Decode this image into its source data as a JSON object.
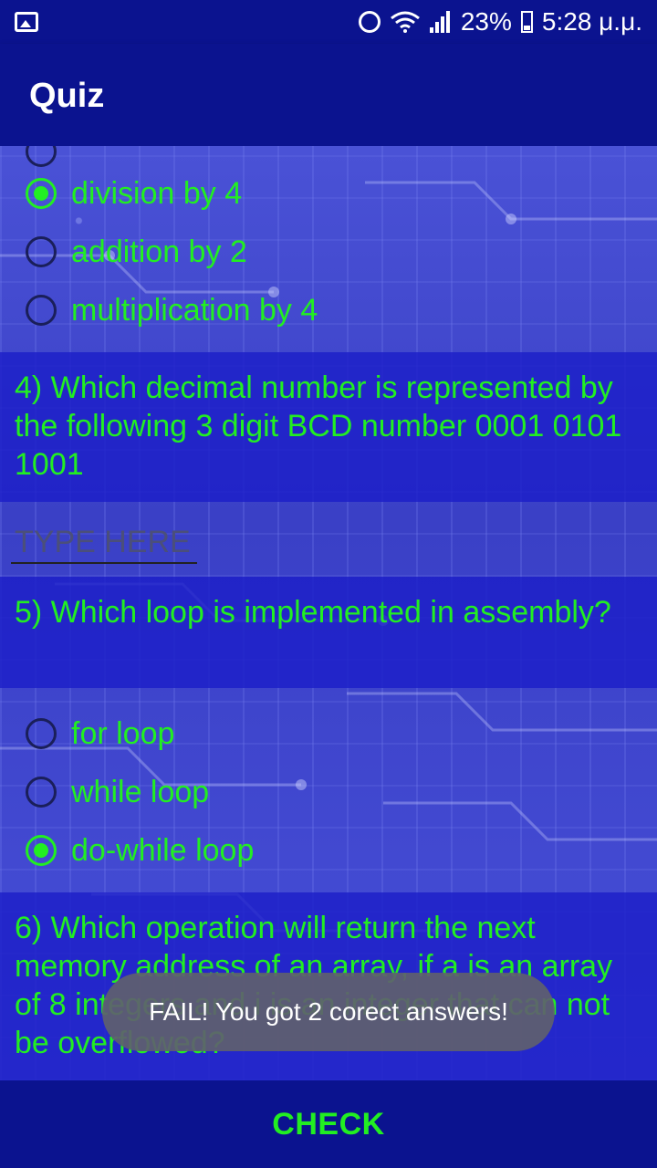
{
  "status_bar": {
    "battery": "23%",
    "time": "5:28 μ.μ."
  },
  "app_bar": {
    "title": "Quiz"
  },
  "question3": {
    "options": [
      {
        "label": "division by 4",
        "selected": true
      },
      {
        "label": "addition by 2",
        "selected": false
      },
      {
        "label": "multiplication by 4",
        "selected": false
      }
    ]
  },
  "question4": {
    "text": "4) Which decimal number is represented by the following 3 digit BCD number 0001 0101 1001",
    "input_placeholder": "TYPE HERE",
    "input_value": ""
  },
  "question5": {
    "text": "5) Which loop is implemented in assembly?",
    "options": [
      {
        "label": "for loop",
        "selected": false
      },
      {
        "label": "while loop",
        "selected": false
      },
      {
        "label": "do-while loop",
        "selected": true
      }
    ]
  },
  "question6": {
    "text": "6) Which operation will return the next memory address of an array, if a is an array of 8 integers and i is an integer that can not be overflowed?"
  },
  "toast": {
    "message": "FAIL! You got 2 corect answers!"
  },
  "bottom_bar": {
    "button_label": "CHECK"
  },
  "colors": {
    "accent": "#22ee22",
    "app_bar": "#0b138f",
    "question_band": "#1c1ec8",
    "toast": "#5f5f6e"
  },
  "icons": [
    "gallery-icon",
    "alarm-icon",
    "wifi-icon",
    "signal-icon",
    "battery-icon"
  ]
}
